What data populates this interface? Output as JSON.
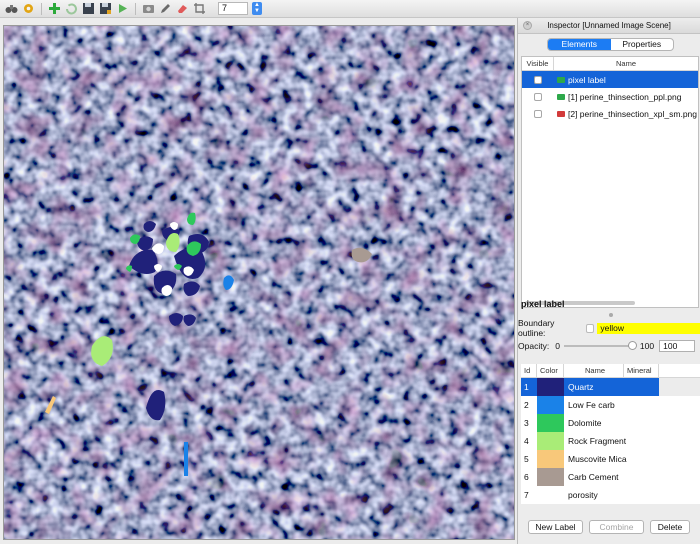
{
  "toolbar": {
    "icons": [
      "binoculars-icon",
      "gear-icon",
      "add-icon",
      "refresh-icon",
      "save-icon",
      "save-as-icon",
      "play-icon",
      "camera-icon",
      "pencil-icon",
      "eraser-icon",
      "crop-icon"
    ],
    "frame_value": "7"
  },
  "inspector": {
    "title": "Inspector [Unnamed Image Scene]",
    "tabs": [
      "Elements",
      "Properties"
    ],
    "active_tab": "Elements",
    "elements_table": {
      "headers": [
        "Visible",
        "Name"
      ],
      "rows": [
        {
          "name": "pixel label",
          "icon_color": "#2da84a",
          "selected": true
        },
        {
          "name": "[1] perine_thinsection_ppl.png",
          "icon_color": "#2da84a",
          "selected": false
        },
        {
          "name": "[2] perine_thinsection_xpl_sm.png",
          "icon_color": "#d23a3a",
          "selected": false
        }
      ]
    },
    "selected_element_title": "pixel label",
    "boundary_label": "Boundary outline:",
    "boundary_value": "yellow",
    "opacity_label": "Opacity:",
    "opacity_min": "0",
    "opacity_max": "100",
    "opacity_value": "100",
    "labels_table": {
      "headers": [
        "Id",
        "Color",
        "Name",
        "Mineral"
      ],
      "rows": [
        {
          "id": "1",
          "color": "#20217a",
          "name": "Quartz",
          "selected": true
        },
        {
          "id": "2",
          "color": "#1a82e8",
          "name": "Low Fe carb",
          "selected": false
        },
        {
          "id": "3",
          "color": "#2ec85c",
          "name": "Dolomite",
          "selected": false
        },
        {
          "id": "4",
          "color": "#a9ec77",
          "name": "Rock Fragment",
          "selected": false
        },
        {
          "id": "5",
          "color": "#f8c87a",
          "name": "Muscovite Mica",
          "selected": false
        },
        {
          "id": "6",
          "color": "#a89a92",
          "name": "Carb Cement",
          "selected": false
        },
        {
          "id": "7",
          "color": "#ffffff",
          "name": "porosity",
          "selected": false
        }
      ]
    },
    "buttons": {
      "new_label": "New Label",
      "combine": "Combine",
      "delete": "Delete"
    }
  }
}
